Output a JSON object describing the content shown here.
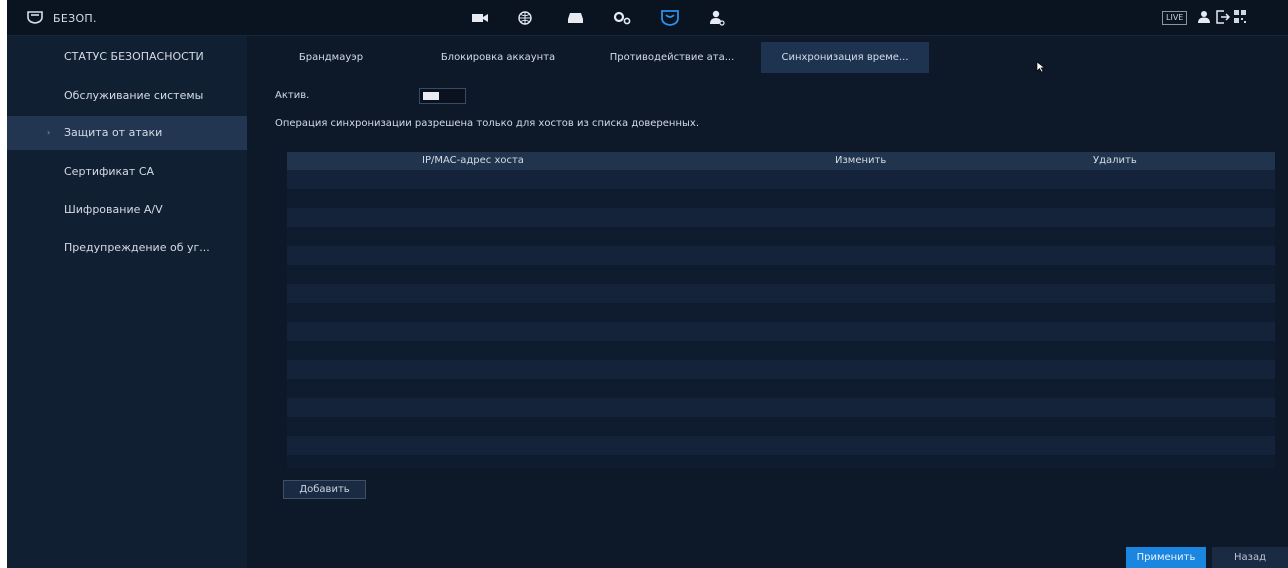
{
  "header": {
    "title": "БЕЗОП.",
    "nav_icons": [
      "camera-icon",
      "network-icon",
      "storage-icon",
      "system-settings-icon",
      "security-icon",
      "account-icon"
    ],
    "active_nav": "security-icon",
    "live_label": "LIVE"
  },
  "sidebar": {
    "items": [
      {
        "label": "СТАТУС БЕЗОПАСНОСТИ"
      },
      {
        "label": "Обслуживание системы"
      },
      {
        "label": "Защита от атаки"
      },
      {
        "label": "Сертификат СА"
      },
      {
        "label": "Шифрование A/V"
      },
      {
        "label": "Предупреждение об уг..."
      }
    ],
    "active_index": 2
  },
  "tabs": [
    {
      "label": "Брандмауэр"
    },
    {
      "label": "Блокировка аккаунта"
    },
    {
      "label": "Противодействие ата..."
    },
    {
      "label": "Синхронизация време..."
    }
  ],
  "active_tab": 3,
  "form": {
    "enable_label": "Актив.",
    "enabled": true,
    "note": "Операция синхронизации разрешена только для хостов из списка доверенных."
  },
  "table": {
    "columns": [
      "IP/MAC-адрес хоста",
      "Изменить",
      "Удалить"
    ],
    "rows": []
  },
  "buttons": {
    "add": "Добавить",
    "apply": "Применить",
    "back": "Назад"
  },
  "colors": {
    "background": "#0d1828",
    "sidebar": "#111f33",
    "accent": "#1b86e0"
  }
}
